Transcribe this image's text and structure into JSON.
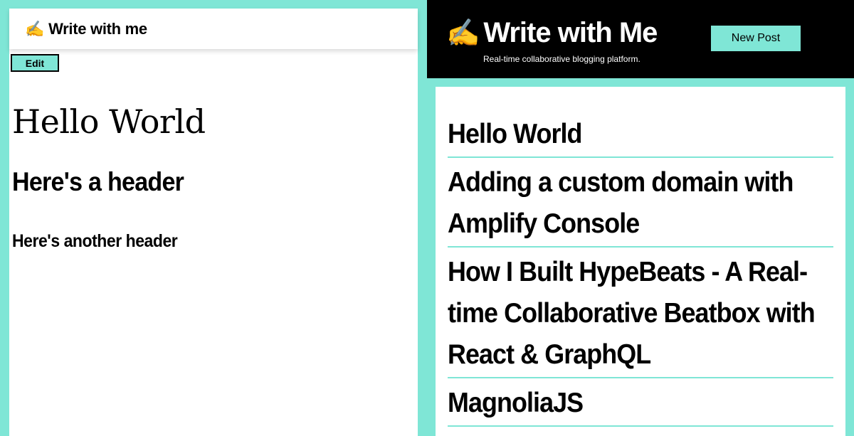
{
  "editor": {
    "app_title": "Write with me",
    "emoji": "✍️",
    "edit_label": "Edit",
    "document": {
      "title": "Hello World",
      "h2": "Here's a header",
      "h3": "Here's another header"
    }
  },
  "site": {
    "emoji": "✍️",
    "title": "Write with Me",
    "tagline": "Real-time collaborative blogging platform.",
    "new_post_label": "New Post",
    "posts": [
      "Hello World",
      "Adding a custom domain with Amplify Console",
      "How I Built HypeBeats - A Real-time Collaborative Beatbox with React & GraphQL",
      "MagnoliaJS"
    ]
  },
  "colors": {
    "accent": "#7fe6d6",
    "header_bg": "#000000"
  }
}
